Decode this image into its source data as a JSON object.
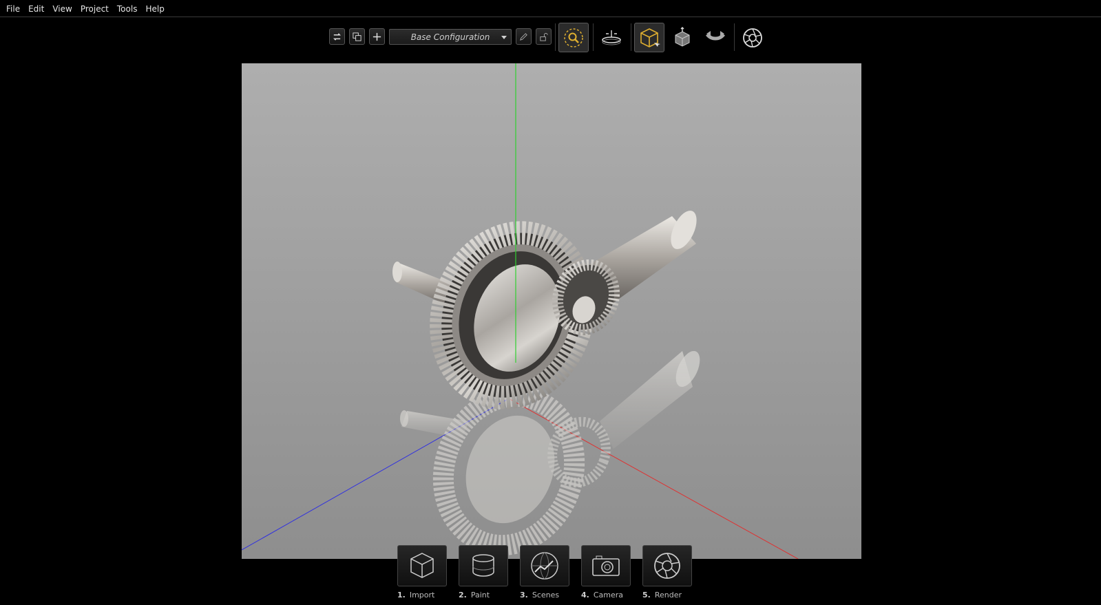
{
  "menu": [
    "File",
    "Edit",
    "View",
    "Project",
    "Tools",
    "Help"
  ],
  "toolbar": {
    "configuration": "Base Configuration",
    "accent_color": "#e0b030"
  },
  "dock": [
    {
      "num": "1.",
      "label": "Import",
      "icon": "cube-icon"
    },
    {
      "num": "2.",
      "label": "Paint",
      "icon": "paint-icon"
    },
    {
      "num": "3.",
      "label": "Scenes",
      "icon": "scenes-icon"
    },
    {
      "num": "4.",
      "label": "Camera",
      "icon": "camera-icon"
    },
    {
      "num": "5.",
      "label": "Render",
      "icon": "aperture-icon"
    }
  ],
  "axis_colors": {
    "x": "#e03030",
    "y": "#30d030",
    "z": "#3030e0"
  }
}
